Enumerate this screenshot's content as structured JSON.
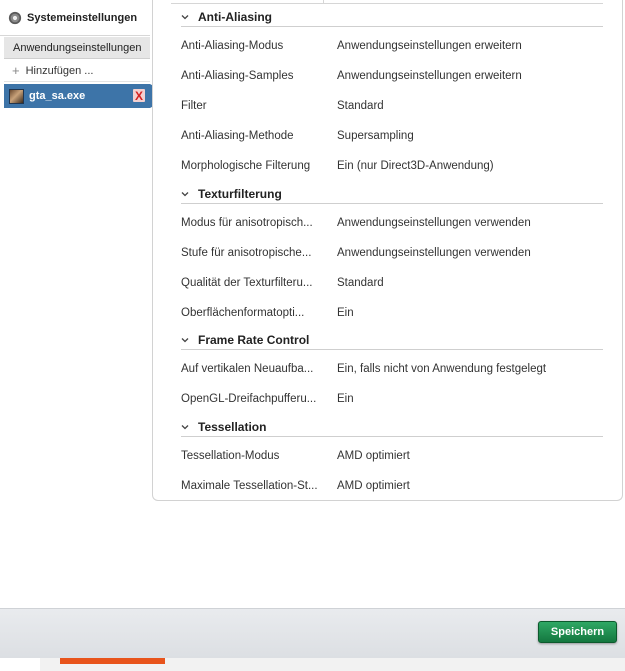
{
  "sidebar": {
    "system_label": "Systemeinstellungen",
    "app_label": "Anwendungseinstellungen",
    "add_label": "Hinzufügen ...",
    "profile_name": "gta_sa.exe",
    "remove_glyph": "X"
  },
  "sections": [
    {
      "title": "Anti-Aliasing",
      "rows": [
        {
          "label": "Anti-Aliasing-Modus",
          "value": "Anwendungseinstellungen erweitern"
        },
        {
          "label": "Anti-Aliasing-Samples",
          "value": "Anwendungseinstellungen erweitern"
        },
        {
          "label": "Filter",
          "value": "Standard"
        },
        {
          "label": "Anti-Aliasing-Methode",
          "value": "Supersampling"
        },
        {
          "label": "Morphologische Filterung",
          "value": "Ein (nur Direct3D-Anwendung)"
        }
      ]
    },
    {
      "title": "Texturfilterung",
      "rows": [
        {
          "label": "Modus für anisotropisch...",
          "value": "Anwendungseinstellungen verwenden"
        },
        {
          "label": "Stufe für anisotropische...",
          "value": "Anwendungseinstellungen verwenden"
        },
        {
          "label": "Qualität der Texturfilteru...",
          "value": "Standard"
        },
        {
          "label": "Oberflächenformatopti...",
          "value": "Ein"
        }
      ]
    },
    {
      "title": "Frame Rate Control",
      "rows": [
        {
          "label": "Auf vertikalen Neuaufba...",
          "value": "Ein, falls nicht von Anwendung festgelegt"
        },
        {
          "label": "OpenGL-Dreifachpufferu...",
          "value": "Ein"
        }
      ]
    },
    {
      "title": "Tessellation",
      "rows": [
        {
          "label": "Tessellation-Modus",
          "value": "AMD optimiert"
        },
        {
          "label": "Maximale Tessellation-St...",
          "value": "AMD optimiert"
        }
      ]
    }
  ],
  "footer": {
    "save_label": "Speichern"
  },
  "colors": {
    "profile_selected": "#3d74a8",
    "save_button": "#1f8f50",
    "orange_strip": "#e8541c"
  },
  "icons": {
    "system": "gear-icon",
    "add": "plus-icon",
    "remove": "remove-x-icon",
    "section_toggle": "chevron-down-icon"
  }
}
